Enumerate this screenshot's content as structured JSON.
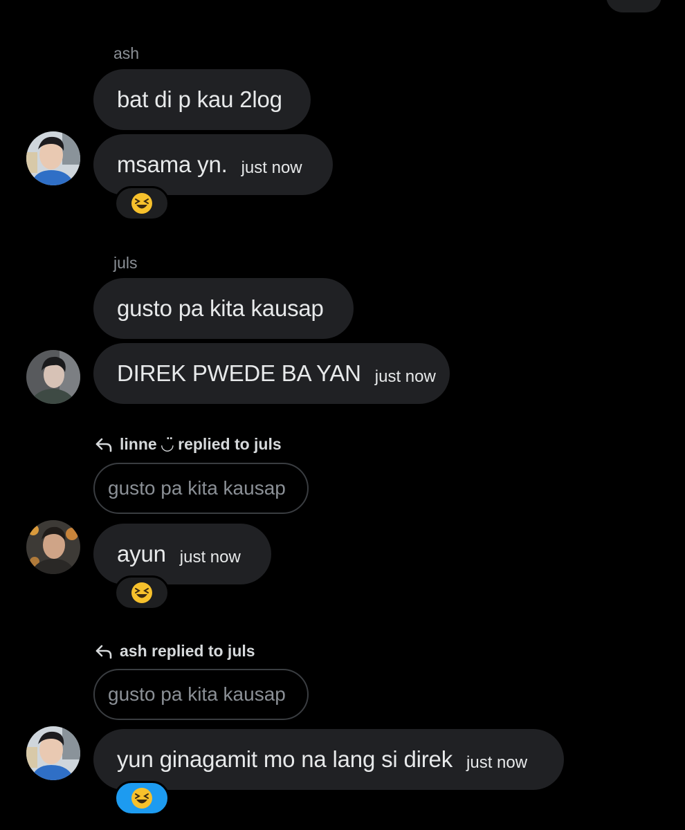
{
  "messages": [
    {
      "sender": "ash",
      "lines": [
        "bat di p kau 2log",
        "msama yn."
      ],
      "time": "just now",
      "reaction": "😆"
    },
    {
      "sender": "juls",
      "lines": [
        "gusto pa kita kausap",
        "DIREK PWEDE BA YAN"
      ],
      "time": "just now"
    },
    {
      "reply_header": "linne ◡̈ replied to juls",
      "quoted": "gusto pa kita kausap",
      "text": "ayun",
      "time": "just now",
      "reaction": "😆"
    },
    {
      "reply_header": "ash replied to juls",
      "quoted": "gusto pa kita kausap",
      "text": "yun ginagamit mo na lang si direk",
      "time": "just now",
      "reaction": "😆"
    }
  ],
  "colors": {
    "background": "#000000",
    "bubble": "#202124",
    "reaction_active": "#1d9bf0",
    "muted_text": "#8b9096"
  },
  "icons": {
    "reply": "reply-arrow-icon",
    "reaction": "grinning-squinting-face-icon",
    "avatar": "user-avatar-photo"
  }
}
